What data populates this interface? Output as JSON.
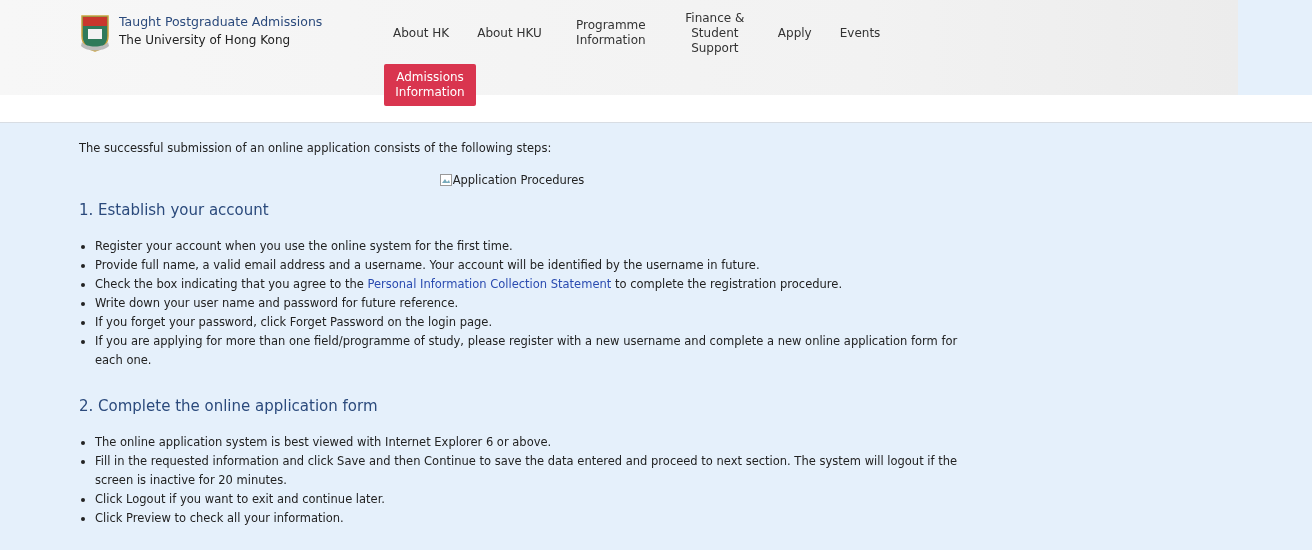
{
  "header": {
    "title": "Taught Postgraduate Admissions",
    "subtitle": "The University of Hong Kong"
  },
  "nav": [
    {
      "label": "About HK",
      "selected": false
    },
    {
      "label": "About HKU",
      "selected": false
    },
    {
      "label": "Programme Information",
      "selected": false
    },
    {
      "label": "Finance & Student Support",
      "selected": false
    },
    {
      "label": "Apply",
      "selected": false
    },
    {
      "label": "Events",
      "selected": false
    },
    {
      "label": "Admissions Information",
      "selected": true
    }
  ],
  "intro": "The successful submission of an online application consists of the following steps:",
  "image_alt": "Application Procedures",
  "sections": [
    {
      "heading": "1. Establish your account",
      "items": [
        [
          {
            "kind": "text",
            "text": "Register your account when you use the online system for the first time."
          }
        ],
        [
          {
            "kind": "text",
            "text": "Provide full name, a valid email address and a username. Your account will be identified by the username in future."
          }
        ],
        [
          {
            "kind": "text",
            "text": "Check the box indicating that you agree to the "
          },
          {
            "kind": "link",
            "text": "Personal Information Collection Statement"
          },
          {
            "kind": "text",
            "text": " to complete the registration procedure."
          }
        ],
        [
          {
            "kind": "text",
            "text": "Write down your user name and password for future reference."
          }
        ],
        [
          {
            "kind": "text",
            "text": "If you forget your password, click Forget Password on the login page."
          }
        ],
        [
          {
            "kind": "text",
            "text": "If you are applying for more than one field/programme of study, please register with a new username and complete a new online application form for each one."
          }
        ]
      ]
    },
    {
      "heading": "2. Complete the online application form",
      "items": [
        [
          {
            "kind": "text",
            "text": "The online application system is best viewed with Internet Explorer 6 or above."
          }
        ],
        [
          {
            "kind": "text",
            "text": "Fill in the requested information and click Save and then Continue to save the data entered and proceed to next section. The system will logout if the screen is inactive for 20 minutes."
          }
        ],
        [
          {
            "kind": "text",
            "text": "Click Logout if you want to exit and continue later."
          }
        ],
        [
          {
            "kind": "text",
            "text": "Click Preview to check all your information."
          }
        ]
      ]
    }
  ]
}
